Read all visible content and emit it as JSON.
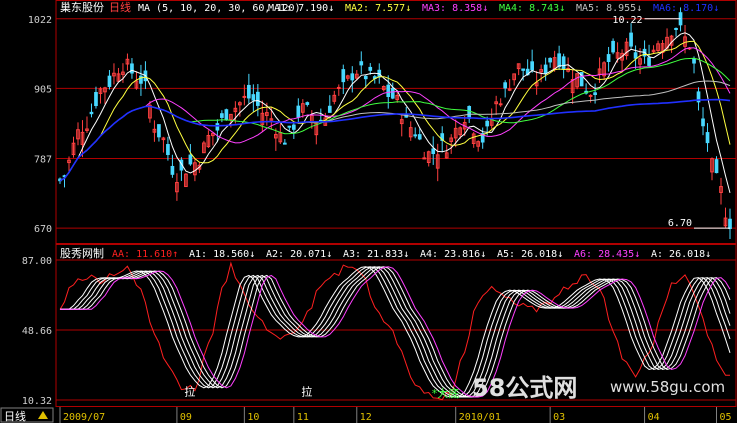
{
  "colors": {
    "background": "#000000",
    "frame": "#b00000",
    "axis_text": "#d0d0d0",
    "price_label": "#ffffff",
    "up_candle": "#ff4040",
    "down_candle": "#48d8ff",
    "ma1": "#ffffff",
    "ma2": "#ffff40",
    "ma3": "#ff40ff",
    "ma4": "#40ff40",
    "ma5": "#c0c0c0",
    "ma6": "#2030ff",
    "aa": "#ff2020",
    "a": "#ffffff",
    "a6": "#ff40ff",
    "signal": "#40ff40",
    "watermark": "#e0e0e0",
    "watermark_accent": "#3070ff"
  },
  "chart_data": [
    {
      "type": "candlestick",
      "title": "巢东股份",
      "period": "日线",
      "indicator": "MA (5, 10, 20, 30, 60, 120)",
      "legend": [
        {
          "name": "MA1",
          "value": "7.190",
          "arrow": "↓",
          "color_key": "ma1"
        },
        {
          "name": "MA2",
          "value": "7.577",
          "arrow": "↓",
          "color_key": "ma2"
        },
        {
          "name": "MA3",
          "value": "8.358",
          "arrow": "↓",
          "color_key": "ma3"
        },
        {
          "name": "MA4",
          "value": "8.743",
          "arrow": "↓",
          "color_key": "ma4"
        },
        {
          "name": "MA5",
          "value": "8.955",
          "arrow": "↓",
          "color_key": "ma5"
        },
        {
          "name": "MA6",
          "value": "8.170",
          "arrow": "↓",
          "color_key": "ma6"
        }
      ],
      "y_ticks": [
        "1022",
        "905",
        "787",
        "670"
      ],
      "ylim": [
        6.5,
        10.3
      ],
      "annotations": [
        {
          "text": "10.22",
          "value": 10.22
        },
        {
          "text": "6.70",
          "value": 6.7
        }
      ],
      "close_anchors": [
        [
          0,
          7.5
        ],
        [
          5,
          8.4
        ],
        [
          10,
          9.1
        ],
        [
          14,
          9.45
        ],
        [
          18,
          9.2
        ],
        [
          22,
          8.3
        ],
        [
          26,
          7.6
        ],
        [
          30,
          7.8
        ],
        [
          34,
          8.3
        ],
        [
          38,
          8.7
        ],
        [
          42,
          8.9
        ],
        [
          46,
          8.6
        ],
        [
          50,
          8.2
        ],
        [
          54,
          8.7
        ],
        [
          58,
          8.5
        ],
        [
          62,
          9.0
        ],
        [
          66,
          9.35
        ],
        [
          70,
          9.2
        ],
        [
          74,
          8.9
        ],
        [
          78,
          8.4
        ],
        [
          82,
          7.95
        ],
        [
          86,
          8.1
        ],
        [
          90,
          8.6
        ],
        [
          94,
          8.2
        ],
        [
          98,
          8.9
        ],
        [
          102,
          9.4
        ],
        [
          106,
          9.2
        ],
        [
          110,
          9.6
        ],
        [
          114,
          9.3
        ],
        [
          118,
          9.0
        ],
        [
          122,
          9.5
        ],
        [
          126,
          9.7
        ],
        [
          130,
          9.5
        ],
        [
          134,
          9.9
        ],
        [
          137,
          10.1
        ],
        [
          140,
          9.8
        ],
        [
          143,
          8.4
        ],
        [
          146,
          7.5
        ],
        [
          149,
          6.8
        ]
      ]
    },
    {
      "type": "line",
      "title": "股秀网制",
      "legend": [
        {
          "name": "AA",
          "value": "11.610",
          "arrow": "↑",
          "color_key": "aa"
        },
        {
          "name": "A1",
          "value": "18.560",
          "arrow": "↓",
          "color_key": "a"
        },
        {
          "name": "A2",
          "value": "20.071",
          "arrow": "↓",
          "color_key": "a"
        },
        {
          "name": "A3",
          "value": "21.833",
          "arrow": "↓",
          "color_key": "a"
        },
        {
          "name": "A4",
          "value": "23.816",
          "arrow": "↓",
          "color_key": "a"
        },
        {
          "name": "A5",
          "value": "26.018",
          "arrow": "↓",
          "color_key": "a"
        },
        {
          "name": "A6",
          "value": "28.435",
          "arrow": "↓",
          "color_key": "a6"
        },
        {
          "name": "A",
          "value": "26.018",
          "arrow": "↓",
          "color_key": "a"
        }
      ],
      "y_ticks": [
        "87.00",
        "48.66",
        "10.32"
      ],
      "ylim": [
        10.32,
        87.0
      ],
      "aa_anchors": [
        [
          0,
          60
        ],
        [
          3,
          75
        ],
        [
          6,
          78
        ],
        [
          9,
          76
        ],
        [
          12,
          80
        ],
        [
          15,
          82
        ],
        [
          18,
          70
        ],
        [
          21,
          48
        ],
        [
          24,
          30
        ],
        [
          27,
          18
        ],
        [
          30,
          16
        ],
        [
          33,
          40
        ],
        [
          36,
          70
        ],
        [
          38,
          84
        ],
        [
          40,
          74
        ],
        [
          43,
          58
        ],
        [
          46,
          50
        ],
        [
          49,
          44
        ],
        [
          52,
          46
        ],
        [
          55,
          58
        ],
        [
          58,
          72
        ],
        [
          61,
          78
        ],
        [
          64,
          85
        ],
        [
          67,
          80
        ],
        [
          70,
          62
        ],
        [
          73,
          52
        ],
        [
          76,
          36
        ],
        [
          78,
          22
        ],
        [
          81,
          14
        ],
        [
          84,
          11
        ],
        [
          87,
          14
        ],
        [
          90,
          38
        ],
        [
          93,
          64
        ],
        [
          96,
          72
        ],
        [
          99,
          68
        ],
        [
          102,
          62
        ],
        [
          105,
          60
        ],
        [
          108,
          62
        ],
        [
          111,
          70
        ],
        [
          114,
          74
        ],
        [
          117,
          78
        ],
        [
          120,
          72
        ],
        [
          123,
          48
        ],
        [
          126,
          30
        ],
        [
          128,
          24
        ],
        [
          131,
          36
        ],
        [
          134,
          60
        ],
        [
          136,
          74
        ],
        [
          139,
          80
        ],
        [
          142,
          62
        ],
        [
          145,
          40
        ],
        [
          147,
          26
        ],
        [
          149,
          22
        ]
      ],
      "a_lag_days": [
        2,
        3,
        4,
        5,
        6,
        7
      ],
      "signals": [
        {
          "text": "拉",
          "index": 29,
          "value": 14
        },
        {
          "text": "拉",
          "index": 55,
          "value": 14
        },
        {
          "text": "*大底",
          "index": 84,
          "value": 10.32
        }
      ]
    }
  ],
  "x_axis": {
    "period_button": "日线",
    "dates": [
      {
        "label": "2009/07",
        "index": 0
      },
      {
        "label": "09",
        "index": 26
      },
      {
        "label": "10",
        "index": 41
      },
      {
        "label": "11",
        "index": 52
      },
      {
        "label": "12",
        "index": 66
      },
      {
        "label": "2010/01",
        "index": 88
      },
      {
        "label": "03",
        "index": 109
      },
      {
        "label": "04",
        "index": 130
      },
      {
        "label": "05",
        "index": 146
      }
    ],
    "count": 150
  },
  "watermark": {
    "text": "58公式网",
    "url": "www.58gu.com"
  }
}
